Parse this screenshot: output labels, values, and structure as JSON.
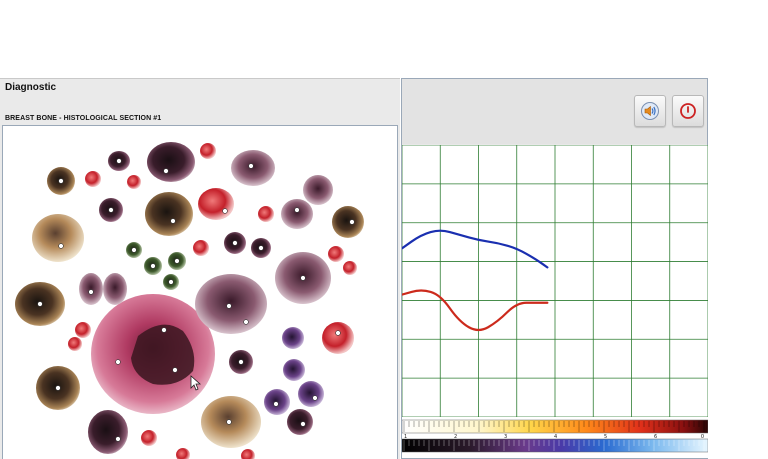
{
  "window": {
    "title": "Diagnostic"
  },
  "section": {
    "title": "BREAST BONE - HISTOLOGICAL SECTION #1"
  },
  "toolbar": {
    "sound_icon": "speaker-icon",
    "power_icon": "power-icon",
    "accent_color": "#cc2222"
  },
  "chart_data": {
    "type": "line",
    "grid": true,
    "grid_color": "#2e7d32",
    "series": [
      {
        "color": "#1a2fb0",
        "x": [
          0,
          0.5,
          1,
          1.5,
          2,
          2.5,
          3,
          3.5,
          3.8
        ],
        "y": [
          0.62,
          0.67,
          0.69,
          0.67,
          0.65,
          0.64,
          0.62,
          0.58,
          0.55
        ]
      },
      {
        "color": "#cc2a1c",
        "x": [
          0,
          0.5,
          1,
          1.5,
          2,
          2.5,
          3,
          3.5,
          3.8
        ],
        "y": [
          0.45,
          0.47,
          0.45,
          0.35,
          0.31,
          0.35,
          0.42,
          0.42,
          0.42
        ]
      }
    ]
  },
  "scale_bar": {
    "tick_labels": [
      "1",
      "2",
      "3",
      "4",
      "5",
      "6",
      "0"
    ]
  }
}
